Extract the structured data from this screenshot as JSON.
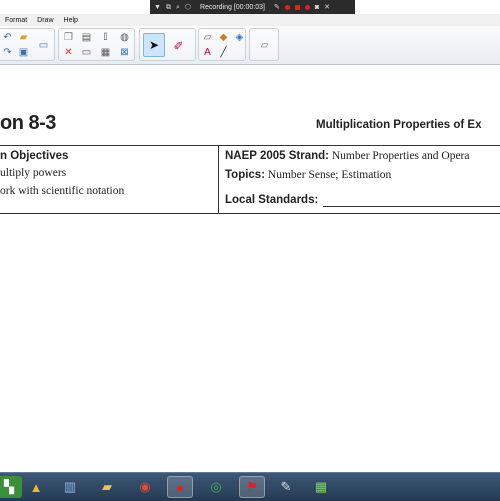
{
  "recording_bar": {
    "label": "Recording [00:00:03]"
  },
  "menu": {
    "items": [
      "Format",
      "Draw",
      "Help"
    ]
  },
  "document": {
    "title": "on 8-3",
    "subtitle": "Multiplication Properties of Ex",
    "objectives_heading": "n Objectives",
    "objectives": [
      "ultiply powers",
      "ork with scientific notation"
    ],
    "naep_label": "NAEP 2005 Strand:",
    "naep_value": "Number Properties and Opera",
    "topics_label": "Topics:",
    "topics_value": "Number Sense; Estimation",
    "local_standards_label": "Local Standards:"
  },
  "colors": {
    "taskbar": "#2f4864",
    "toolbar_selected": "#cde4fb",
    "record": "#e02020"
  }
}
